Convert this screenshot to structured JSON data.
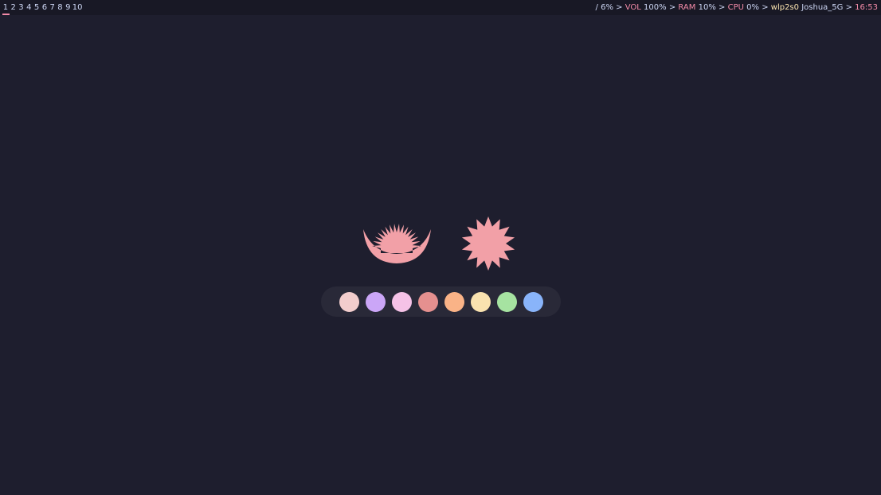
{
  "workspaces": [
    "1",
    "2",
    "3",
    "4",
    "5",
    "6",
    "7",
    "8",
    "9",
    "10"
  ],
  "active_workspace": "1",
  "status": {
    "disk_sep": "/",
    "disk_value": "6%",
    "sep": ">",
    "vol_label": "VOL",
    "vol_value": "100%",
    "ram_label": "RAM",
    "ram_value": "10%",
    "cpu_label": "CPU",
    "cpu_value": "0%",
    "net_iface": "wlp2s0",
    "net_ssid": "Joshua_5G",
    "time": "16:53"
  },
  "colors": {
    "background": "#1e1e2e",
    "bar": "#181825",
    "accent": "#f38ba8",
    "eyes": "#f2a0a7"
  },
  "icons": [
    "smile-eye-icon",
    "star-burst-icon"
  ],
  "palette": [
    "#f2cdcd",
    "#cba6f7",
    "#f5c2e7",
    "#e5908f",
    "#fab387",
    "#f9e2af",
    "#a6e3a1",
    "#89b4fa"
  ]
}
